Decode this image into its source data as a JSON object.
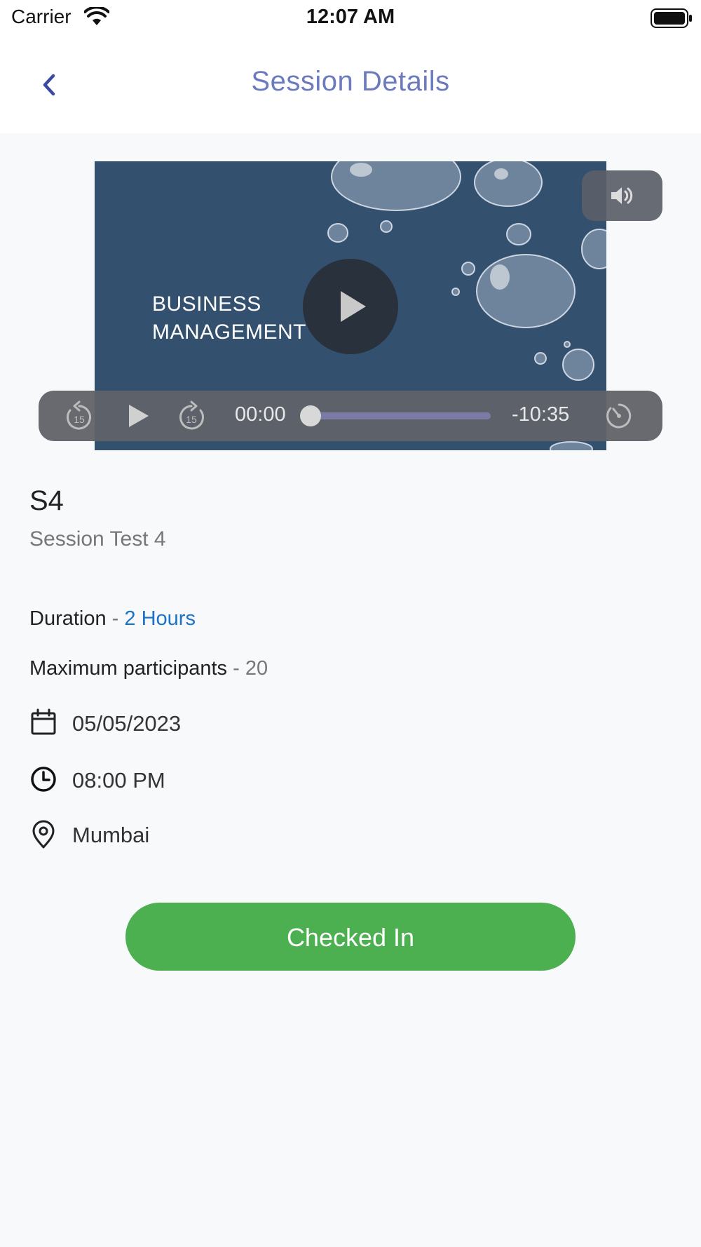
{
  "status_bar": {
    "carrier": "Carrier",
    "time": "12:07 AM"
  },
  "nav": {
    "back_icon": "chevron-left-icon",
    "title": "Session Details"
  },
  "video": {
    "thumbnail_text_line1": "BUSINESS",
    "thumbnail_text_line2": "MANAGEMENT",
    "current_time": "00:00",
    "remaining_time": "-10:35",
    "progress": 0.0,
    "icons": [
      "play-icon",
      "volume-icon",
      "rewind-15-icon",
      "forward-15-icon",
      "playback-speed-icon"
    ]
  },
  "session": {
    "code": "S4",
    "name": "Session Test 4",
    "duration_label": "Duration",
    "duration_sep": " - ",
    "duration_value": "2 Hours",
    "participants_label": "Maximum participants",
    "participants_sep": " - ",
    "participants_value": "20",
    "date": "05/05/2023",
    "time": "08:00 PM",
    "location": "Mumbai"
  },
  "actions": {
    "checkin_label": "Checked In"
  },
  "colors": {
    "nav_title": "#6b7bbd",
    "accent_blue": "#1a73c8",
    "button_green": "#4caf50",
    "video_bg": "#34506f"
  }
}
